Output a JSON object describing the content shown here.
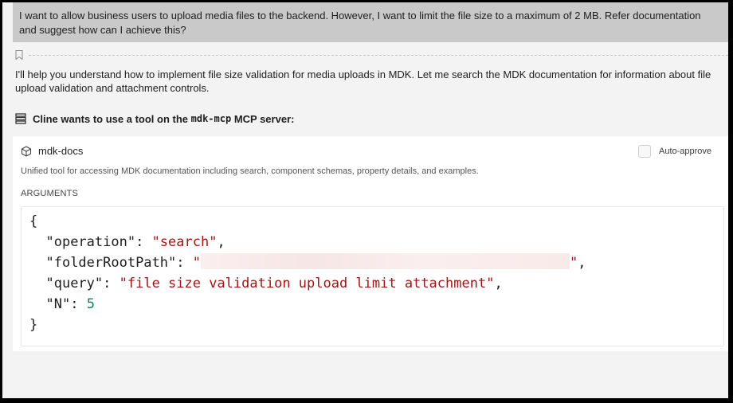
{
  "user_message": "I want to allow business users to upload media files to the backend. However, I want to limit the file size to a maximum of 2 MB. Refer documentation and suggest how can I achieve this?",
  "assistant_message": "I'll help you understand how to implement file size validation for media uploads in MDK. Let me search the MDK documentation for information about file upload validation and attachment controls.",
  "tool_request": {
    "prefix": "Cline wants to use a tool on the ",
    "server": "mdk-mcp",
    "suffix": " MCP server:",
    "icon": "server-icon"
  },
  "tool": {
    "name": "mdk-docs",
    "icon": "cube-icon",
    "auto_approve_label": "Auto-approve",
    "auto_approve_checked": false,
    "description": "Unified tool for accessing MDK documentation including search, component schemas, property details, and examples.",
    "arguments_label": "ARGUMENTS",
    "arguments": {
      "open_brace": "{",
      "close_brace": "}",
      "operation_key": "\"operation\"",
      "operation_value": "\"search\"",
      "folder_key": "\"folderRootPath\"",
      "folder_value_open": "\"",
      "folder_value_close": "\"",
      "query_key": "\"query\"",
      "query_value": "\"file size validation upload limit attachment\"",
      "n_key": "\"N\"",
      "n_value": "5"
    }
  },
  "colors": {
    "string": "#a31515",
    "number": "#098658",
    "user_bubble": "#c9c9c9",
    "panel_bg": "#f3f3f3"
  }
}
